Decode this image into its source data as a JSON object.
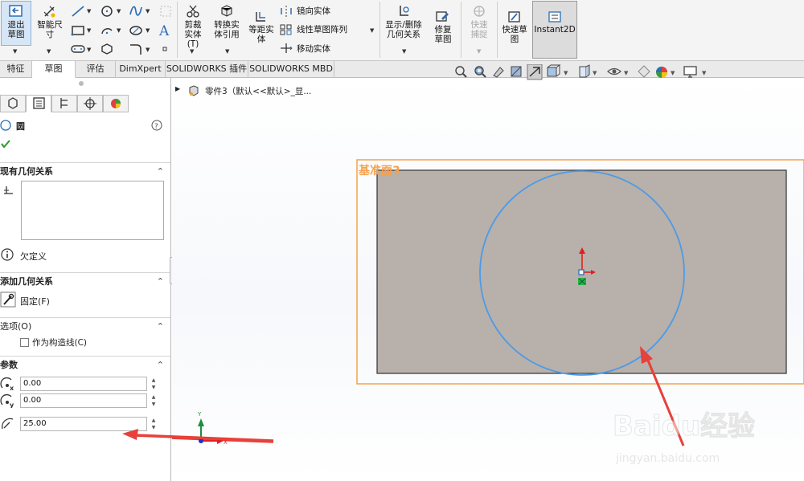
{
  "ribbon": {
    "exit_sketch": "退出草图",
    "smart_dim": "智能尺寸",
    "trim": "剪裁实体(T)",
    "convert": "转换实体引用",
    "offset": "等距实体",
    "mirror": "镜向实体",
    "linear_pattern": "线性草图阵列",
    "move": "移动实体",
    "display_relations": "显示/删除几何关系",
    "repair": "修复草图",
    "quick_snap": "快速捕捉",
    "rapid_sketch": "快速草图",
    "instant2d": "Instant2D"
  },
  "tabs": [
    "特征",
    "草图",
    "评估",
    "DimXpert",
    "SOLIDWORKS 插件",
    "SOLIDWORKS MBD"
  ],
  "tree": {
    "part": "零件3（默认<<默认>_显..."
  },
  "panel": {
    "title": "圆",
    "existing_relations": "现有几何关系",
    "status": "欠定义",
    "add_relations": "添加几何关系",
    "fix": "固定(F)",
    "options": "选项(O)",
    "construction": "作为构造线(C)",
    "params": "参数",
    "cx": "0.00",
    "cy": "0.00",
    "radius": "25.00"
  },
  "viewport": {
    "plane_label": "基准面3",
    "watermark_1": "Baidu经验",
    "watermark_2": "jingyan.baidu.com",
    "axis_y": "Y",
    "axis_x": "X"
  },
  "colors": {
    "plane_border": "#f6a14c",
    "plane_fill": "#b8b0aa",
    "circle": "#4a9be8",
    "arrow": "#e8403a"
  }
}
